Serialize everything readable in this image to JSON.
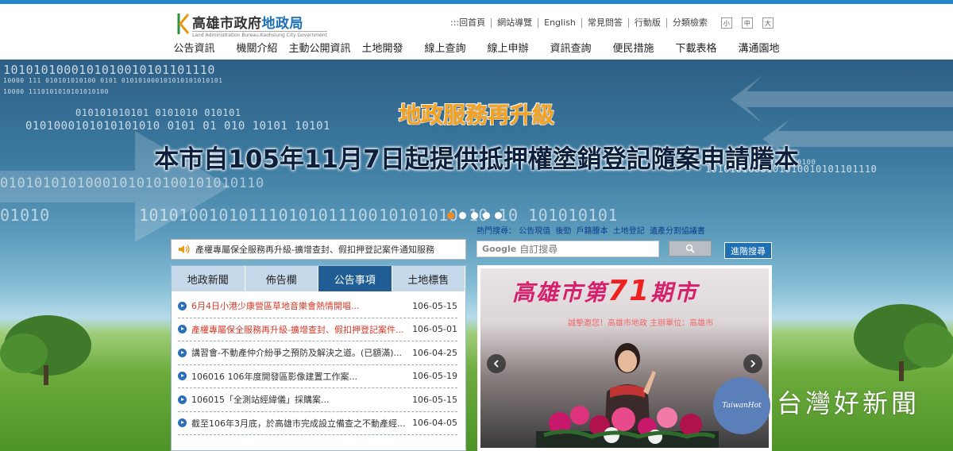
{
  "colors": {
    "accent": "#1f86c8",
    "nav_active": "#1f5d94",
    "headline_orange": "#f7a21b",
    "headline_dark": "#0c1f3c",
    "news_red": "#d43a2a"
  },
  "logo": {
    "title_prefix": "高雄市政府",
    "title_highlight": "地政局",
    "subtitle": "Land Administration Bureau,Kaohsiung City Government"
  },
  "utility_links": [
    "回首頁",
    "網站導覽",
    "English",
    "常見問答",
    "行動版",
    "分類檢索"
  ],
  "font_size_buttons": [
    "小",
    "中",
    "大"
  ],
  "main_nav": [
    "公告資訊",
    "機關介紹",
    "主動公開資訊",
    "土地開發",
    "線上查詢",
    "線上申辦",
    "資訊查詢",
    "便民措施",
    "下載表格",
    "溝通園地"
  ],
  "banner": {
    "headline_1": "地政服務再升級",
    "headline_2": "本市自105年11月7日起提供抵押權塗銷登記隨案申請謄本",
    "binary": [
      "1010101000101010010101101110",
      "10000 111        010101010100    0101       010101000101010101010101",
      "10000 1110101010101010100",
      "010101010101 0101010 010101",
      "0101000101010101010    0101    01 010 10101 10101",
      "0101010101000101010100101010110",
      "01010",
      "101010010101110101011100",
      "10101010  10 10 101010101",
      "101000 10000 1110101010101010100",
      "1010101000101010010101101110"
    ],
    "slide_count": 5,
    "active_slide": 0
  },
  "hot_search": {
    "label": "熱門搜尋：",
    "terms": [
      "公告現值",
      "後勁",
      "戶籍謄本",
      "土地登記",
      "遺產分割協議書"
    ]
  },
  "notice": {
    "text": "產權專屬保全服務再升級-擴增查封、假扣押登記案件通知服務"
  },
  "search": {
    "brand": "Google",
    "placeholder": "自訂搜尋",
    "advanced_label": "進階搜尋"
  },
  "news": {
    "tabs": [
      "地政新聞",
      "佈告欄",
      "公告事項",
      "土地標售"
    ],
    "active_tab": 2,
    "items": [
      {
        "title": "6月4日小港少康營區草地音樂會熱情開唱...",
        "date": "106-05-15",
        "highlight": true
      },
      {
        "title": "產權專屬保全服務再升級-擴增查封、假扣押登記案件...",
        "date": "106-05-01",
        "highlight": true
      },
      {
        "title": "講習會-不動產仲介紛爭之預防及解決之道。(已額滿)...",
        "date": "106-04-25",
        "highlight": false
      },
      {
        "title": "106016 106年度開發區影像建置工作案...",
        "date": "106-05-19",
        "highlight": false
      },
      {
        "title": "106015「全測站經緯儀」採購案...",
        "date": "106-05-15",
        "highlight": false
      },
      {
        "title": "截至106年3月底，於高雄市完成設立備查之不動產經...",
        "date": "106-04-05",
        "highlight": false
      }
    ]
  },
  "carousel": {
    "title_prefix": "高雄市第",
    "title_number": "71",
    "title_suffix": "期市",
    "subtitle": "誠摯邀您！高雄市地政  主辦單位：高雄市"
  },
  "watermark": {
    "logo_text": "TaiwanHot",
    "text": "台灣好新聞"
  }
}
